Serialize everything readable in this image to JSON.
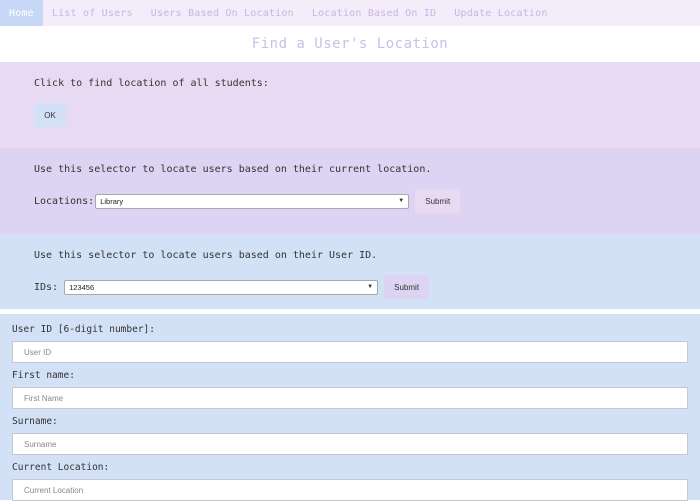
{
  "nav": {
    "items": [
      {
        "label": "Home",
        "active": true
      },
      {
        "label": "List of Users"
      },
      {
        "label": "Users Based On Location"
      },
      {
        "label": "Location Based On ID"
      },
      {
        "label": "Update Location"
      }
    ]
  },
  "page_title": "Find a User's Location",
  "section_all": {
    "instruction": "Click to find location of all students:",
    "button_label": "OK"
  },
  "section_location": {
    "instruction": "Use this selector to locate users based on their current location.",
    "label": "Locations:",
    "selected": "Library",
    "submit_label": "Submit"
  },
  "section_id": {
    "instruction": "Use this selector to locate users based on their User ID.",
    "label": "IDs:",
    "selected": "123456",
    "submit_label": "Submit"
  },
  "form": {
    "fields": [
      {
        "label": "User ID [6-digit number]:",
        "placeholder": "User ID"
      },
      {
        "label": "First name:",
        "placeholder": "First Name"
      },
      {
        "label": "Surname:",
        "placeholder": "Surname"
      },
      {
        "label": "Current Location:",
        "placeholder": "Current Location"
      }
    ]
  },
  "colors": {
    "nav_bg": "#f3ecf9",
    "nav_active": "#c6d8f5",
    "section_lavender": "#e9daf4",
    "section_purple": "#dcd4f2",
    "section_blue": "#d3e1f7"
  }
}
